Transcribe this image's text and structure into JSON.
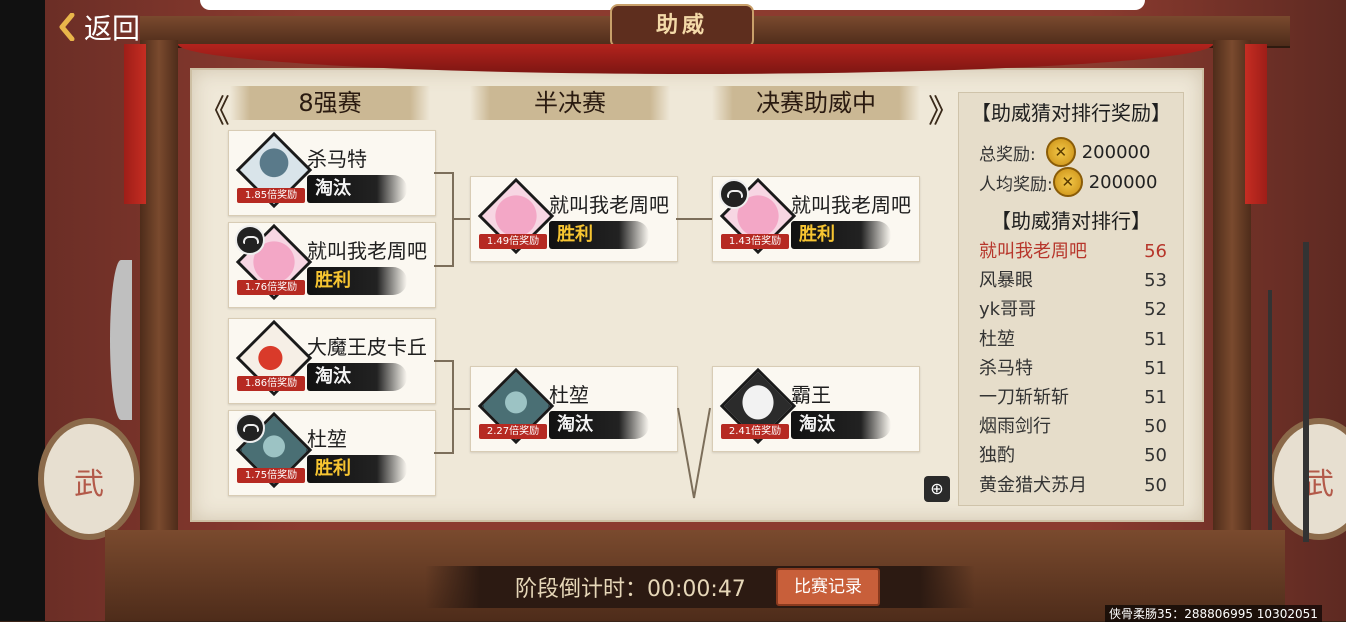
{
  "header": {
    "back_label": "返回",
    "title": "助威"
  },
  "stages": {
    "quarter": "8强赛",
    "semi": "半决赛",
    "final": "决赛助威中",
    "nav_prev": "《",
    "nav_next": "》"
  },
  "bracket": {
    "quarter": [
      {
        "name": "杀马特",
        "odds": "1.85倍奖励",
        "result": "淘汰",
        "status": "lose",
        "avatar": "photo-avatar"
      },
      {
        "name": "就叫我老周吧",
        "odds": "1.76倍奖励",
        "result": "胜利",
        "status": "win",
        "avatar": "pink-creature-avatar"
      },
      {
        "name": "大魔王皮卡丘",
        "odds": "1.86倍奖励",
        "result": "淘汰",
        "status": "lose",
        "avatar": "red-figure-avatar"
      },
      {
        "name": "杜堃",
        "odds": "1.75倍奖励",
        "result": "胜利",
        "status": "win",
        "avatar": "teal-figure-avatar"
      }
    ],
    "semi": [
      {
        "name": "就叫我老周吧",
        "odds": "1.49倍奖励",
        "result": "胜利",
        "status": "win",
        "avatar": "pink-creature-avatar"
      },
      {
        "name": "杜堃",
        "odds": "2.27倍奖励",
        "result": "淘汰",
        "status": "lose",
        "avatar": "teal-figure-avatar"
      }
    ],
    "final": [
      {
        "name": "就叫我老周吧",
        "odds": "1.43倍奖励",
        "result": "胜利",
        "status": "win",
        "avatar": "pink-creature-avatar"
      },
      {
        "name": "霸王",
        "odds": "2.41倍奖励",
        "result": "淘汰",
        "status": "lose",
        "avatar": "white-hair-avatar"
      }
    ]
  },
  "rank_panel": {
    "title": "【助威猜对排行奖励】",
    "total_label": "总奖励:",
    "total_value": "200000",
    "avg_label": "人均奖励:",
    "avg_value": "200000",
    "coin_glyph": "✕",
    "rank_title": "【助威猜对排行】",
    "items": [
      {
        "name": "就叫我老周吧",
        "score": "56"
      },
      {
        "name": "风暴眼",
        "score": "53"
      },
      {
        "name": "yk哥哥",
        "score": "52"
      },
      {
        "name": "杜堃",
        "score": "51"
      },
      {
        "name": "杀马特",
        "score": "51"
      },
      {
        "name": "一刀斩斩斩",
        "score": "51"
      },
      {
        "name": "烟雨剑行",
        "score": "50"
      },
      {
        "name": "独酌",
        "score": "50"
      },
      {
        "name": "黄金猎犬苏月",
        "score": "50"
      }
    ]
  },
  "footer": {
    "countdown": "阶段倒计时：00:00:47",
    "record_button": "比赛记录",
    "watermark": "侠骨柔肠35：288806995  10302051"
  },
  "decor": {
    "drum_glyph": "武"
  },
  "colors": {
    "win": "#f7c531",
    "lose": "#f4f4f4",
    "odds_bg": "#b62a22",
    "first_rank": "#b7362b"
  }
}
